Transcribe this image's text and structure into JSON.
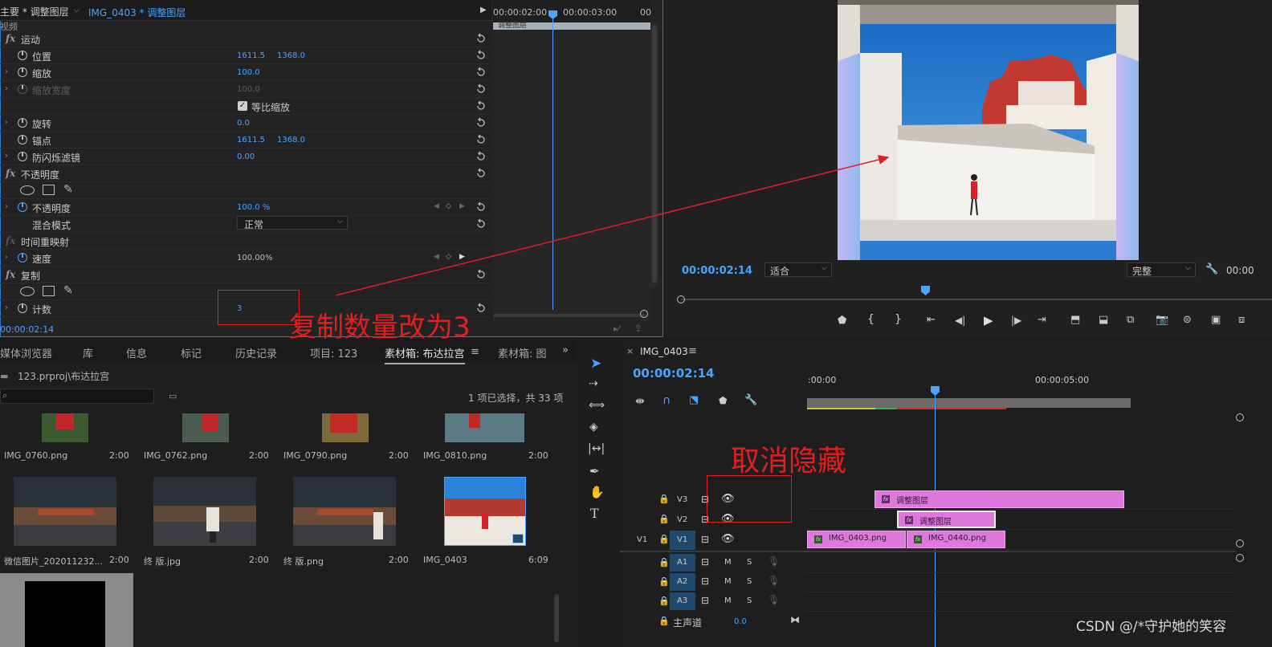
{
  "effect_controls": {
    "source_tab": "主要 * 调整图层",
    "seq_tab": "IMG_0403 * 调整图层",
    "section_label": "视频",
    "rows": {
      "motion": "运动",
      "position": "位置",
      "position_x": "1611.5",
      "position_y": "1368.0",
      "scale": "缩放",
      "scale_v": "100.0",
      "scale_width": "缩放宽度",
      "scale_width_v": "100.0",
      "uniform_scale": "等比缩放",
      "rotation": "旋转",
      "rotation_v": "0.0",
      "anchor": "锚点",
      "anchor_x": "1611.5",
      "anchor_y": "1368.0",
      "antiflicker": "防闪烁滤镜",
      "antiflicker_v": "0.00",
      "opacity_section": "不透明度",
      "opacity": "不透明度",
      "opacity_v": "100.0 %",
      "blend_mode": "混合模式",
      "blend_mode_v": "正常",
      "time_remap": "时间重映射",
      "speed": "速度",
      "speed_v": "100.00%",
      "replicate": "复制",
      "count": "计数",
      "count_v": "3"
    },
    "ruler": {
      "t1": "00:00:02:00",
      "t2": "00:00:03:00",
      "t3": "00"
    },
    "clip_label": "调整图层",
    "timecode": "00:00:02:14"
  },
  "program_monitor": {
    "timecode": "00:00:02:14",
    "fit": "适合",
    "quality": "完整",
    "end_timecode": "00:00"
  },
  "project": {
    "tabs": [
      "媒体浏览器",
      "库",
      "信息",
      "标记",
      "历史记录",
      "项目: 123",
      "素材箱: 布达拉宫",
      "素材箱: 图"
    ],
    "path": "123.prproj\\布达拉宫",
    "selection": "1 项已选择，共 33 项",
    "items": [
      {
        "name": "IMG_0760.png",
        "dur": "2:00"
      },
      {
        "name": "IMG_0762.png",
        "dur": "2:00"
      },
      {
        "name": "IMG_0790.png",
        "dur": "2:00"
      },
      {
        "name": "IMG_0810.png",
        "dur": "2:00"
      },
      {
        "name": "微信图片_202011232...",
        "dur": "2:00"
      },
      {
        "name": "终 版.jpg",
        "dur": "2:00"
      },
      {
        "name": "终 版.png",
        "dur": "2:00"
      },
      {
        "name": "IMG_0403",
        "dur": "6:09"
      }
    ]
  },
  "timeline": {
    "seq_name": "IMG_0403",
    "timecode": "00:00:02:14",
    "ruler_start": ":00:00",
    "ruler_mid": "00:00:05:00",
    "tracks": {
      "v3": "V3",
      "v2": "V2",
      "v1_src": "V1",
      "v1": "V1",
      "a1": "A1",
      "a2": "A2",
      "a3": "A3",
      "m": "M",
      "s": "S",
      "master": "主声道",
      "master_v": "0.0"
    },
    "clips": {
      "adj1": "调整图层",
      "adj2": "调整图层",
      "img0403": "IMG_0403.png",
      "img0440": "IMG_0440.png"
    }
  },
  "annotations": {
    "copy_note": "复制数量改为3",
    "unhide_note": "取消隐藏",
    "watermark": "CSDN @/*守护她的笑容"
  },
  "colors": {
    "accent": "#4aa3ff",
    "clip": "#dd79dd",
    "annotation": "#e02020"
  }
}
